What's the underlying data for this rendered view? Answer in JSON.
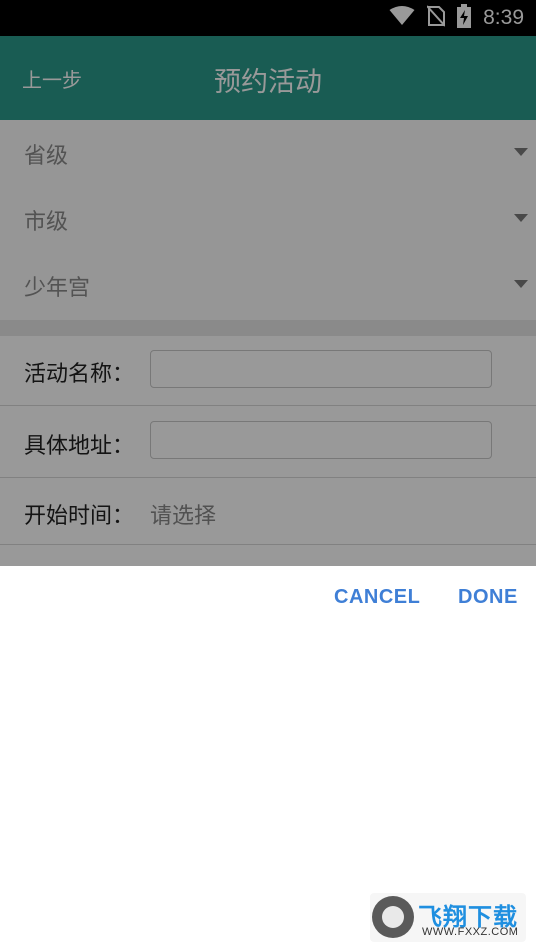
{
  "status_bar": {
    "time": "8:39",
    "icons": [
      "wifi-icon",
      "no-sim-icon",
      "battery-charging-icon"
    ]
  },
  "app_bar": {
    "back_label": "上一步",
    "title": "预约活动",
    "color": "#2a9a8a"
  },
  "region_selects": [
    {
      "label": "省级"
    },
    {
      "label": "市级"
    },
    {
      "label": "少年宫"
    }
  ],
  "form": {
    "activity_name_label": "活动名称：",
    "activity_name_value": "",
    "address_label": "具体地址：",
    "address_value": "",
    "start_time_label": "开始时间：",
    "start_time_value": "请选择"
  },
  "dialog": {
    "cancel_label": "CANCEL",
    "done_label": "DONE",
    "accent_color": "#3f7fd6"
  },
  "watermark": {
    "brand": "飞翔下载",
    "site": "WWW.FXXZ.COM"
  }
}
